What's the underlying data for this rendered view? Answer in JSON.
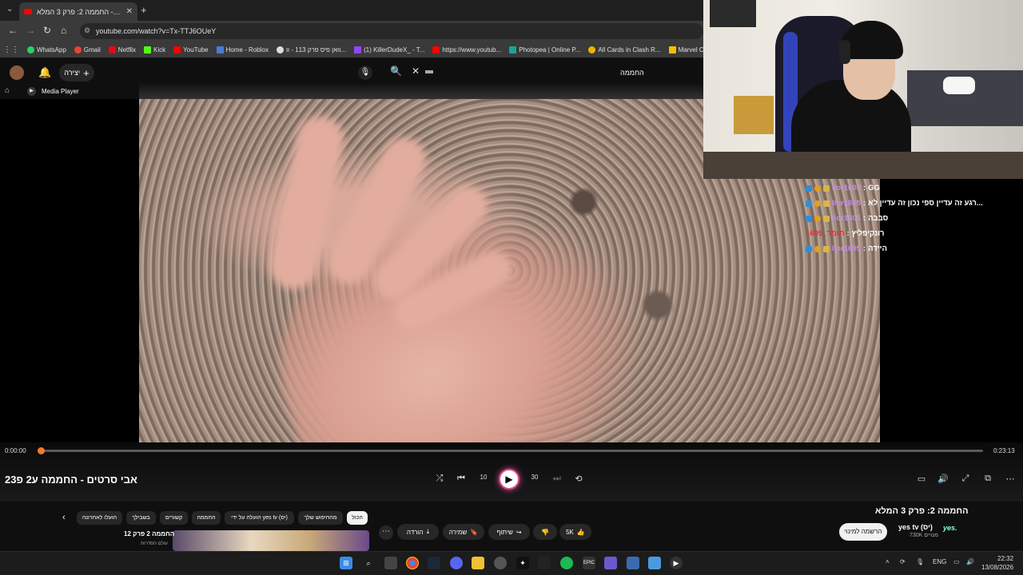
{
  "browser": {
    "tab_title": "החממה 2: פרק 3 המלא - Tube",
    "tab_close": "✕",
    "new_tab": "+",
    "tab_menu": "⌄",
    "url": "youtube.com/watch?v=Tx-TTJ6OUeY",
    "nav_back": "←",
    "nav_forward": "→",
    "nav_reload": "↻",
    "nav_home": "⌂",
    "bookmarks": [
      "WhatsApp",
      "Gmail",
      "Netflix",
      "Kick",
      "YouTube",
      "Home - Roblox",
      "וואן פיס פרק 113 - וו...",
      "(1) KillerDudeX_ - T...",
      "https://www.youtub...",
      "Photopea | Online P...",
      "All Cards in Clash R...",
      "Marvel Cine"
    ]
  },
  "yt_header": {
    "create_label": "יצירה",
    "create_plus": "+",
    "bell": "🔔",
    "mic": "🎙",
    "search": "🔍",
    "clear": "✕",
    "channel_label": "החממה"
  },
  "subbar": {
    "home": "⌂",
    "mp_icon": "▶",
    "label": "Media Player"
  },
  "player": {
    "time_current": "0:00:00",
    "time_total": "0:23:13",
    "progress": 0.0,
    "title": "אבי סרטים - החממה ע2 פ23",
    "play": "▶",
    "shuffle": "⤮",
    "prev": "⏮",
    "rewind": "10",
    "forward": "30",
    "next": "⏭",
    "repeat": "⟲",
    "right_controls": [
      "▭",
      "🔊",
      "⤢",
      "⧉",
      "⋯"
    ]
  },
  "video_page": {
    "title": "החממה 2: פרק 3 המלא",
    "channel": "yes tv (יס)",
    "subs": "730K מנויים",
    "logo": "yes.",
    "subscribe": "הרשמה למינוי",
    "like_count": "5K",
    "share": "שיתוף",
    "save": "שמירה",
    "download": "הורדה",
    "more": "⋯",
    "chips": [
      "הכול",
      "מהחיפוש שלך",
      "הועלה על ידי yes tv (יס)",
      "החממה",
      "קשורים",
      "בשבילך",
      "הועלו לאחרונה"
    ],
    "chip_back": "‹",
    "related_title": "החממה 2 פרק 12",
    "related_sub": "עולם הסדרות"
  },
  "chat": [
    {
      "user": "lior1605",
      "text": "GG",
      "red": false
    },
    {
      "user": "lior1605",
      "text": "רגע זה עדיין ספי נכון זה עדיין לא...",
      "red": false
    },
    {
      "user": "lior1605",
      "text": "סבבה",
      "red": false
    },
    {
      "user": "תומר_1605",
      "text": "רונקיפליץ",
      "red": true
    },
    {
      "user": "lior1605",
      "text": "היידה",
      "red": false
    }
  ],
  "taskbar": {
    "lang": "ENG",
    "time": "22:32",
    "date": "13/08/2026"
  },
  "colors": {
    "accent": "#f07b2a",
    "chat_user": "#c58af9",
    "glow": "#d94a8c"
  }
}
